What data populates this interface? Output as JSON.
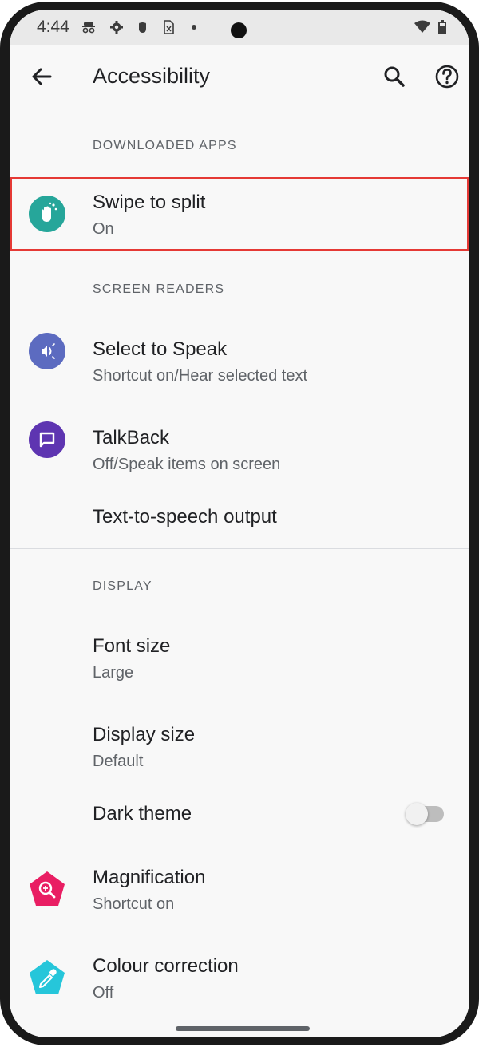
{
  "status_bar": {
    "time": "4:44",
    "icons": [
      "incognito-icon",
      "settings-icon",
      "hand-icon",
      "sim-icon",
      "dot-icon",
      "wifi-icon",
      "battery-icon"
    ]
  },
  "app_bar": {
    "title": "Accessibility",
    "back_icon": "arrow-back-icon",
    "search_icon": "search-icon",
    "help_icon": "help-icon"
  },
  "sections": {
    "downloaded_apps": "DOWNLOADED APPS",
    "screen_readers": "SCREEN READERS",
    "display": "DISPLAY"
  },
  "items": {
    "swipe_to_split": {
      "title": "Swipe to split",
      "subtitle": "On",
      "icon": "wave-hand-icon",
      "color": "#26a69a"
    },
    "select_to_speak": {
      "title": "Select to Speak",
      "subtitle": "Shortcut on/Hear selected text",
      "icon": "speaker-icon",
      "color": "#5c6bc0"
    },
    "talkback": {
      "title": "TalkBack",
      "subtitle": "Off/Speak items on screen",
      "icon": "chat-bubble-icon",
      "color": "#5e35b1"
    },
    "tts_output": {
      "title": "Text-to-speech output"
    },
    "font_size": {
      "title": "Font size",
      "subtitle": "Large"
    },
    "display_size": {
      "title": "Display size",
      "subtitle": "Default"
    },
    "dark_theme": {
      "title": "Dark theme",
      "enabled": false
    },
    "magnification": {
      "title": "Magnification",
      "subtitle": "Shortcut on",
      "icon": "zoom-in-icon",
      "color": "#e91e63"
    },
    "colour_correction": {
      "title": "Colour correction",
      "subtitle": "Off",
      "icon": "eyedropper-icon",
      "color": "#26c6da"
    }
  },
  "highlight_color": "#e53935"
}
